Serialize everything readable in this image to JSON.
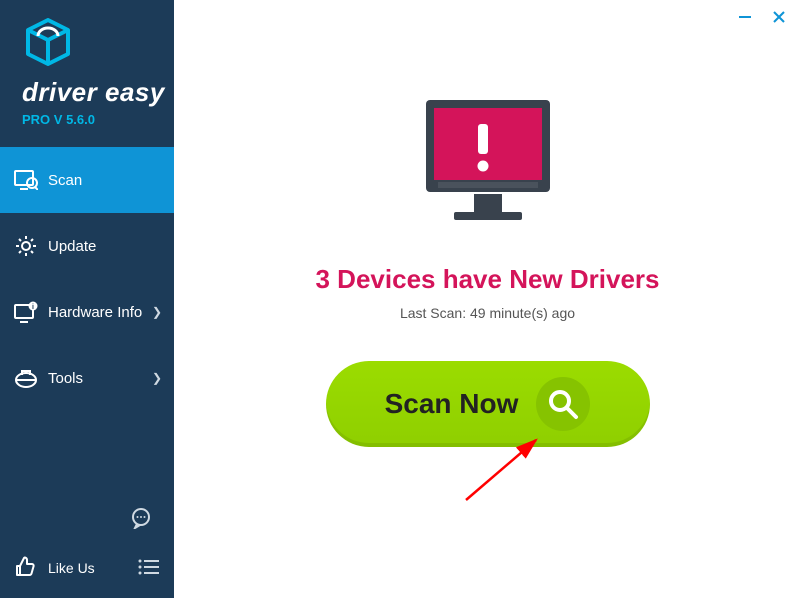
{
  "brand": {
    "name": "driver easy",
    "version": "PRO V 5.6.0"
  },
  "sidebar": {
    "items": [
      {
        "label": "Scan"
      },
      {
        "label": "Update"
      },
      {
        "label": "Hardware Info"
      },
      {
        "label": "Tools"
      }
    ],
    "like": "Like Us"
  },
  "main": {
    "headline": "3 Devices have New Drivers",
    "subline": "Last Scan: 49 minute(s) ago",
    "scan_button": "Scan Now"
  },
  "icons": {
    "scan": "scan-icon",
    "update": "gear-icon",
    "hardware": "monitor-info-icon",
    "tools": "toolbag-icon",
    "chat": "chat-bubble-icon",
    "menu": "menu-lines-icon",
    "thumb": "thumbs-up-icon",
    "minimize": "minimize-icon",
    "close": "close-icon",
    "search": "search-icon",
    "logo": "cube-logo-icon",
    "monitor_alert": "monitor-alert-icon",
    "chevron": "chevron-right-icon"
  }
}
